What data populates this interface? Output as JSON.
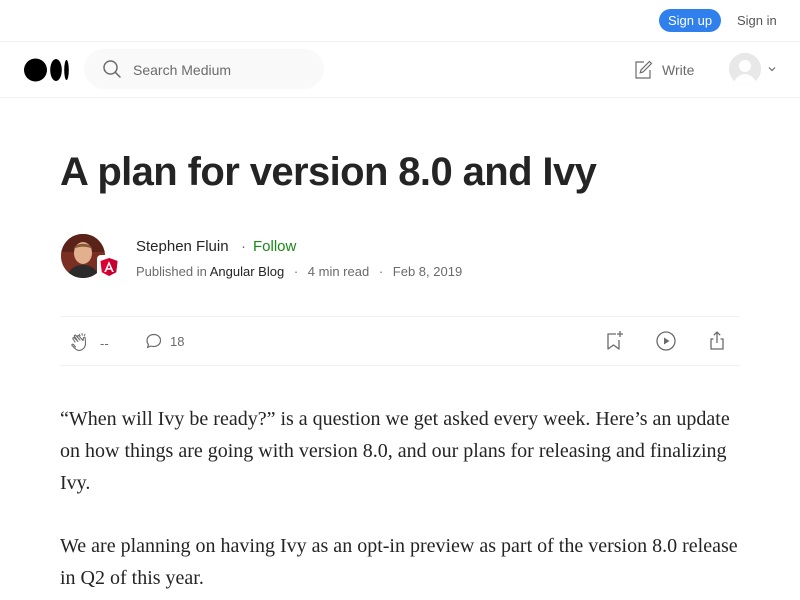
{
  "topbar": {
    "signup_label": "Sign up",
    "signin_label": "Sign in"
  },
  "header": {
    "logo": "medium-logo",
    "search": {
      "placeholder": "Search Medium",
      "value": ""
    },
    "write_label": "Write"
  },
  "article": {
    "title": "A plan for version 8.0 and Ivy",
    "author": {
      "name": "Stephen Fluin",
      "follow_label": "Follow",
      "dot": "·"
    },
    "meta": {
      "published_in": "Published in",
      "publication": "Angular Blog",
      "sep": "·",
      "read_time": "4 min read",
      "date": "Feb 8, 2019"
    },
    "actions": {
      "claps": "--",
      "responses": "18"
    },
    "paragraphs": [
      "“When will Ivy be ready?” is a question we get asked every week. Here’s an update on how things are going with version 8.0, and our plans for releasing and finalizing Ivy.",
      "We are planning on having Ivy as an opt-in preview as part of the version 8.0 release in Q2 of this year."
    ]
  },
  "colors": {
    "accent": "#2f80ed",
    "follow": "#1a8917",
    "text": "#242424",
    "muted": "#6b6b6b"
  }
}
